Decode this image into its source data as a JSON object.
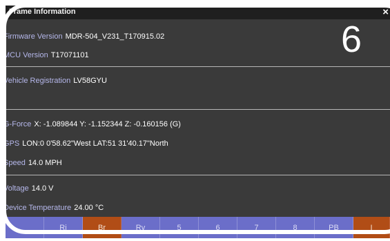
{
  "window": {
    "title": "Frame Information",
    "close_icon": "×"
  },
  "badge": "6",
  "info": {
    "firmware": {
      "label": "Firmware Version",
      "value": "MDR-504_V231_T170915.02"
    },
    "mcu": {
      "label": "MCU Version",
      "value": "T17071101"
    },
    "vehicle": {
      "label": "Vehicle Registration",
      "value": "LV58GYU"
    },
    "gforce": {
      "label": "G-Force",
      "value": "X: -1.089844 Y: -1.152344 Z: -0.160156 (G)"
    },
    "gps": {
      "label": "GPS",
      "value": "LON:0 0'58.62\"West  LAT:51 31'40.17\"North"
    },
    "speed": {
      "label": "Speed",
      "value": "14.0 MPH"
    },
    "voltage": {
      "label": "Voltage",
      "value": "14.0 V"
    },
    "temperature": {
      "label": "Device Temperature",
      "value": "24.00 °C"
    }
  },
  "tabs": [
    "",
    "Ri",
    "Br",
    "Rv",
    "5",
    "6",
    "7",
    "8",
    "PB",
    "I"
  ],
  "colors": {
    "tab": "#6b6ec9",
    "tab_active": "#b14d16",
    "background": "#3a3a3a",
    "label": "#b5b7ea"
  }
}
